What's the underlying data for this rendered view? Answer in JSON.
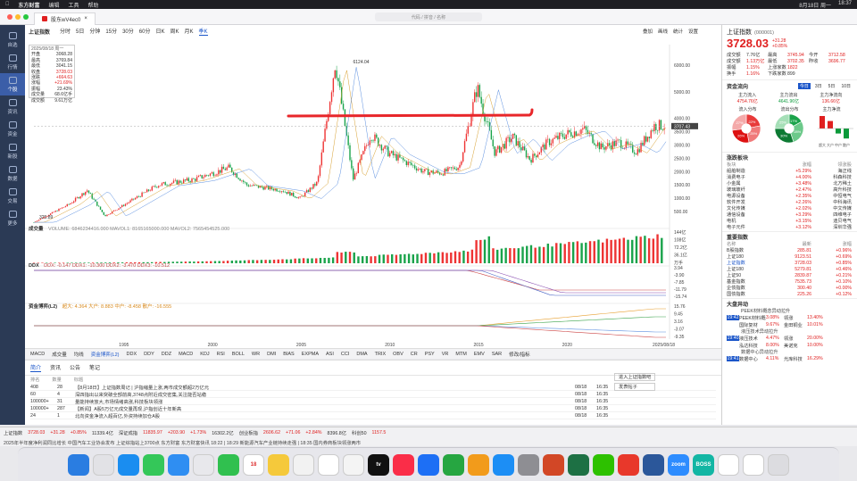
{
  "menubar": {
    "app": "东方财富",
    "items": [
      "编辑",
      "工具",
      "帮助"
    ],
    "right": [
      "8月18日 周一",
      "18:37"
    ]
  },
  "window": {
    "tab_title": "股东wV4ec0",
    "address": "代码 / 拼音 / 名称"
  },
  "sidebar": {
    "items": [
      {
        "label": "自选",
        "icon": "star-icon"
      },
      {
        "label": "行情",
        "icon": "chart-icon"
      },
      {
        "label": "个股",
        "icon": "stock-icon"
      },
      {
        "label": "资讯",
        "icon": "news-icon"
      },
      {
        "label": "资金",
        "icon": "money-icon"
      },
      {
        "label": "新股",
        "icon": "new-icon"
      },
      {
        "label": "数据",
        "icon": "data-icon"
      },
      {
        "label": "交易",
        "icon": "trade-icon"
      },
      {
        "label": "更多",
        "icon": "more-icon"
      }
    ],
    "active": 2
  },
  "toolbar": {
    "name": "上证指数",
    "periods": [
      "分时",
      "5日",
      "分钟",
      "15分",
      "30分",
      "60分",
      "日K",
      "周K",
      "月K",
      "季K"
    ],
    "selected": "季K",
    "right": [
      "叠加",
      "画线",
      "统计",
      "设置"
    ]
  },
  "info_box": {
    "date": "2025/08/18 周一",
    "rows": [
      [
        "开盘",
        "3068.28"
      ],
      [
        "最高",
        "3769.84"
      ],
      [
        "最低",
        "3041.15"
      ],
      [
        "收盘",
        "3728.03"
      ],
      [
        "涨跌",
        "+664.63"
      ],
      [
        "涨幅",
        "+21.69%"
      ],
      [
        "振幅",
        "23.43%"
      ],
      [
        "成交量",
        "68.6亿手"
      ],
      [
        "成交额",
        "9.61万亿"
      ]
    ]
  },
  "main_chart": {
    "high_label": "6124.04",
    "low_label": "325.89",
    "y_ticks": [
      "6000.00",
      "5000.00",
      "4000.00",
      "3707.43",
      "3500.00",
      "3000.00",
      "2500.00",
      "2000.00",
      "1500.00",
      "1000.00",
      "500.00"
    ],
    "x_ticks": [
      "1995",
      "2000",
      "2005",
      "2010",
      "2015",
      "2020",
      "2025/08/18"
    ],
    "annotation_color": "#e8262a"
  },
  "panels": {
    "volume": {
      "title": "成交量",
      "legend": "VOLUME: 6846234416.000  MAVOL1: 8165165000.000  MAVOL2: 7565454525.000",
      "ticks": [
        "144亿",
        "108亿",
        "72.2亿",
        "36.1亿",
        "万手"
      ]
    },
    "ddx": {
      "title": "DDX",
      "legend": "DDX: -0.147  DDX1: -10.300  DDX2: -3.470  DDX3: -10.512",
      "ticks": [
        "3.94",
        "-3.90",
        "-7.85",
        "-11.79",
        "-15.74"
      ]
    },
    "fund": {
      "title": "资金博弈(L2)",
      "legend": "超大: 4.364  大户: 8.883  中户: -8.458  散户: -16.555",
      "ticks": [
        "15.76",
        "9.45",
        "3.16",
        "-3.07",
        "-9.35"
      ]
    }
  },
  "indicator_tabs": [
    "MACD",
    "成交量",
    "均线",
    "资金博弈(L2)",
    "DDX",
    "DDY",
    "DDZ",
    "MACD",
    "KDJ",
    "RSI",
    "BOLL",
    "WR",
    "DMI",
    "BIAS",
    "EXPMA",
    "ASI",
    "CCI",
    "DMA",
    "TRIX",
    "OBV",
    "CR",
    "PSY",
    "VR",
    "MTM",
    "EMV",
    "SAR",
    "修改/指标"
  ],
  "news": {
    "tabs": [
      "简介",
      "资讯",
      "公告",
      "笔记"
    ],
    "header": [
      "排名",
      "数量",
      "标题"
    ],
    "rows": [
      [
        "408",
        "28",
        "【8月18日】上证指数周记 | 沪指缩量上涨,两市成交额超2万亿元",
        "08/18",
        "16:35"
      ],
      [
        "60",
        "4",
        "深四指出以来突破全部前高,3748点附近成交密集,关注能否站稳",
        "08/18",
        "16:35"
      ],
      [
        "100000+",
        "31",
        "量能持续放大,市场情绪高涨,科技板块领涨",
        "08/18",
        "16:35"
      ],
      [
        "100000+",
        "287",
        "【新闻】A股5万亿元成交量再现,沪指创近十年新高",
        "08/18",
        "16:35"
      ],
      [
        "24",
        "1",
        "北向资金净流入超百亿,外资持续加仓A股",
        "08/18",
        "16:35"
      ]
    ],
    "buttons": [
      "进入上证指数吧",
      "发表帖子"
    ]
  },
  "status": {
    "line1": [
      "上证指数",
      "3728.03",
      "+31.28",
      "+0.85%",
      "11339.4亿",
      "深证成指",
      "11835.97",
      "+203.90",
      "+1.73%",
      "16302.2亿",
      "创业板指",
      "2606.62",
      "+71.06",
      "+2.84%",
      "8396.8亿",
      "科创50",
      "1157.5"
    ],
    "line2": "2025年半年度净利润同比增长 中国汽车工业协会发布 上证综指站上3700点 东方财富 东方财富快讯 18:22 | 18:29 新能源汽车产业链持续走强 | 18:35 国内券商板块领涨两市"
  },
  "right_panel": {
    "name": "上证指数",
    "code": "(000001)",
    "price": "3728.03",
    "change": "+31.28",
    "pct": "+0.85%",
    "stats": [
      [
        "成交额",
        "7.76亿",
        "最高",
        "3745.94",
        "今开",
        "3712.58"
      ],
      [
        "成交额",
        "1.13万亿",
        "最低",
        "3702.35",
        "昨收",
        "3696.77"
      ],
      [
        "振幅",
        "1.15%",
        "上涨家数",
        "1822",
        "",
        ""
      ],
      [
        "换手",
        "1.16%",
        "下跌家数",
        "899",
        "",
        ""
      ]
    ],
    "flow_title": "资金流向",
    "flow_tabs": [
      "今日",
      "3日",
      "5日",
      "10日"
    ],
    "flow_cols": [
      [
        "主力流入",
        "4754.76亿"
      ],
      [
        "主力流出",
        "4641.96亿"
      ],
      [
        "主力净流向",
        "136.66亿"
      ]
    ],
    "flow_labels": [
      "流入分布",
      "流出分布",
      "主力净流"
    ],
    "pie_in": [
      "22%",
      "25%",
      "26%",
      "27%"
    ],
    "pie_out": [
      "17%",
      "28%",
      "30%",
      "25%"
    ],
    "bar_labels": [
      "超大",
      "大户",
      "中户",
      "散户"
    ],
    "sector_title": "涨跌板块",
    "sector_header": [
      "板块",
      "涨幅",
      "领涨股"
    ],
    "sectors": [
      [
        "船舶制造",
        "+5.29%",
        "海正线"
      ],
      [
        "消费电子",
        "+4.00%",
        "科森科技"
      ],
      [
        "小金属",
        "+3.48%",
        "北方稀土"
      ],
      [
        "玻璃玻纤",
        "+2.47%",
        "高升科技"
      ],
      [
        "电源设备",
        "+2.35%",
        "中恒电气"
      ],
      [
        "软件开发",
        "+2.26%",
        "中科海讯"
      ],
      [
        "文化传媒",
        "+2.02%",
        "中文传媒"
      ],
      [
        "通信设备",
        "+3.29%",
        "四维电子"
      ],
      [
        "电机",
        "+3.15%",
        "迪贝电气"
      ],
      [
        "电子元件",
        "+3.12%",
        "深圳华强"
      ]
    ],
    "index_title": "重要指数",
    "index_header": [
      "名称",
      "最新",
      "涨幅"
    ],
    "indices": [
      [
        "B股指数",
        "285.81",
        "+0.96%"
      ],
      [
        "上证180",
        "9123.51",
        "+0.69%"
      ],
      [
        "上证指数",
        "3728.03",
        "+0.85%"
      ],
      [
        "上证180",
        "5279.81",
        "+0.46%"
      ],
      [
        "上证50",
        "2839.87",
        "+0.21%"
      ],
      [
        "基金指数",
        "7535.73",
        "+0.10%"
      ],
      [
        "企债指数",
        "300.40",
        "+0.00%"
      ],
      [
        "国债指数",
        "225.26",
        "+0.12%"
      ]
    ],
    "news_title": "大盘异动",
    "events": [
      [
        "19:42",
        "PEEK材料概念异动拉升",
        "PEEK材料概念",
        "3.08%",
        "领涨",
        "13.40%"
      ],
      [
        "",
        "",
        "国际复材",
        "9.67%",
        "金田铜业",
        "10.01%"
      ],
      [
        "19:40",
        "液压技术异动拉升",
        "液压技术",
        "4.47%",
        "领涨",
        "20.00%"
      ],
      [
        "",
        "",
        "泓达科技",
        "8.00%",
        "美诺克",
        "10.00%"
      ],
      [
        "19:41",
        "数据中心异动拉升",
        "数据中心",
        "4.11%",
        "光库科技",
        "16.29%"
      ]
    ]
  },
  "dock": {
    "apps": [
      {
        "name": "finder-icon",
        "color": "#2a7de1",
        "label": ""
      },
      {
        "name": "launchpad-icon",
        "color": "#e2e2e6",
        "label": ""
      },
      {
        "name": "safari-icon",
        "color": "#1a8df0",
        "label": ""
      },
      {
        "name": "messages-icon",
        "color": "#34c759",
        "label": ""
      },
      {
        "name": "mail-icon",
        "color": "#2f8ef2",
        "label": ""
      },
      {
        "name": "appstore-icon",
        "color": "#e8e8ec",
        "label": ""
      },
      {
        "name": "facetime-icon",
        "color": "#30c04f",
        "label": ""
      },
      {
        "name": "calendar-icon",
        "color": "#ffffff",
        "label": "18"
      },
      {
        "name": "notes-icon",
        "color": "#f5c93b",
        "label": ""
      },
      {
        "name": "photos-icon",
        "color": "#f2f2f2",
        "label": ""
      },
      {
        "name": "reminders-icon",
        "color": "#ffffff",
        "label": ""
      },
      {
        "name": "freeform-icon",
        "color": "#f4f4f4",
        "label": ""
      },
      {
        "name": "tv-icon",
        "color": "#111111",
        "label": "tv"
      },
      {
        "name": "music-icon",
        "color": "#fa2d48",
        "label": ""
      },
      {
        "name": "keynote-icon",
        "color": "#1d6ff5",
        "label": ""
      },
      {
        "name": "numbers-icon",
        "color": "#26a641",
        "label": ""
      },
      {
        "name": "pages-icon",
        "color": "#f29b1b",
        "label": ""
      },
      {
        "name": "appstore2-icon",
        "color": "#1c8ef5",
        "label": ""
      },
      {
        "name": "settings-icon",
        "color": "#8e8e93",
        "label": ""
      },
      {
        "name": "powerpoint-icon",
        "color": "#d24726",
        "label": ""
      },
      {
        "name": "excel-icon",
        "color": "#1d7044",
        "label": ""
      },
      {
        "name": "wechat-icon",
        "color": "#2dc100",
        "label": ""
      },
      {
        "name": "eastmoney-icon",
        "color": "#e8382b",
        "label": ""
      },
      {
        "name": "word-icon",
        "color": "#2b579a",
        "label": ""
      },
      {
        "name": "zoom-icon",
        "color": "#2d8cff",
        "label": "zoom"
      },
      {
        "name": "boss-icon",
        "color": "#13b6a4",
        "label": "BOSS"
      },
      {
        "name": "onedrive-icon",
        "color": "#ffffff",
        "label": ""
      },
      {
        "name": "preview-icon",
        "color": "#ffffff",
        "label": ""
      },
      {
        "name": "trash-icon",
        "color": "#dcdce0",
        "label": ""
      }
    ]
  }
}
